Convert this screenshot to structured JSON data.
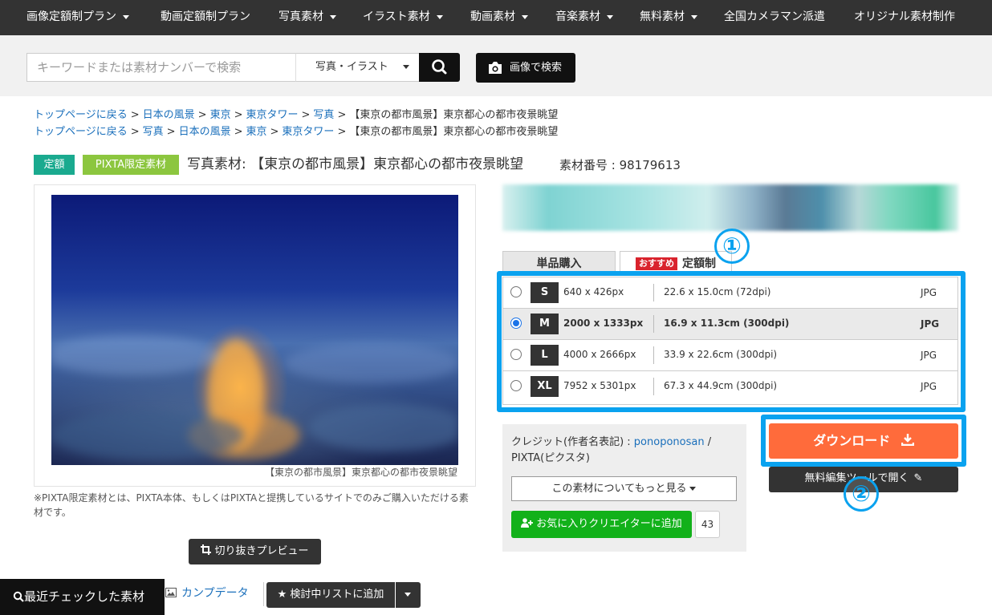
{
  "topnav": {
    "items": [
      {
        "label": "画像定額制プラン",
        "dropdown": true
      },
      {
        "label": "動画定額制プラン",
        "dropdown": false
      },
      {
        "label": "写真素材",
        "dropdown": true
      },
      {
        "label": "イラスト素材",
        "dropdown": true
      },
      {
        "label": "動画素材",
        "dropdown": true
      },
      {
        "label": "音楽素材",
        "dropdown": true
      },
      {
        "label": "無料素材",
        "dropdown": true
      },
      {
        "label": "全国カメラマン派遣",
        "dropdown": false
      },
      {
        "label": "オリジナル素材制作",
        "dropdown": false
      }
    ]
  },
  "search": {
    "placeholder": "キーワードまたは素材ナンバーで検索",
    "category": "写真・イラスト",
    "image_search_label": "画像で検索",
    "search_icon": "search-icon"
  },
  "breadcrumbs": [
    [
      "トップページに戻る",
      "日本の風景",
      "東京",
      "東京タワー",
      "写真"
    ],
    [
      "トップページに戻る",
      "写真",
      "日本の風景",
      "東京",
      "東京タワー"
    ]
  ],
  "breadcrumb_current": "【東京の都市風景】東京都心の都市夜景眺望",
  "breadcrumb_separator": ">",
  "title_row": {
    "badge_subscription": "定額",
    "badge_pixta": "PIXTA限定素材",
    "title": "写真素材: 【東京の都市風景】東京都心の都市夜景眺望",
    "item_number": "素材番号 : 98179613"
  },
  "preview": {
    "caption": "【東京の都市風景】東京都心の都市夜景眺望",
    "pixta_note": "※PIXTA限定素材とは、PIXTA本体、もしくはPIXTAと提携しているサイトでのみご購入いただける素材です。",
    "crop_preview_label": "切り抜きプレビュー",
    "comp_data_label": "カンプデータ",
    "add_list_label": "検討中リストに追加"
  },
  "recent": {
    "label": "最近チェックした素材"
  },
  "tabs": {
    "single": "単品購入",
    "recommend_tag": "おすすめ",
    "subscription": "定額制"
  },
  "sizes": [
    {
      "label": "S",
      "px": "640 x 426px",
      "cm": "22.6 x 15.0cm (72dpi)",
      "format": "JPG",
      "selected": false
    },
    {
      "label": "M",
      "px": "2000 x 1333px",
      "cm": "16.9 x 11.3cm (300dpi)",
      "format": "JPG",
      "selected": true
    },
    {
      "label": "L",
      "px": "4000 x 2666px",
      "cm": "33.9 x 22.6cm (300dpi)",
      "format": "JPG",
      "selected": false
    },
    {
      "label": "XL",
      "px": "7952 x 5301px",
      "cm": "67.3 x 44.9cm (300dpi)",
      "format": "JPG",
      "selected": false
    }
  ],
  "credit": {
    "prefix": "クレジット(作者名表記) : ",
    "author": "ponoponosan",
    "suffix": " / PIXTA(ピクスタ)",
    "more_label": "この素材についてもっと見る",
    "fav_creator_label": "お気に入りクリエイターに追加",
    "fav_count": "43"
  },
  "actions": {
    "download_label": "ダウンロード",
    "editor_label": "無料編集ツールで開く"
  },
  "annotations": {
    "one": "①",
    "two": "②"
  },
  "colors": {
    "accent_download": "#ff6b3b",
    "accent_green": "#12b11a",
    "badge_teal": "#1aaa8f",
    "badge_lime": "#8cc63f",
    "highlight_blue": "#0aa2ef",
    "link_blue": "#1a6fbb",
    "nav_dark": "#333333"
  }
}
